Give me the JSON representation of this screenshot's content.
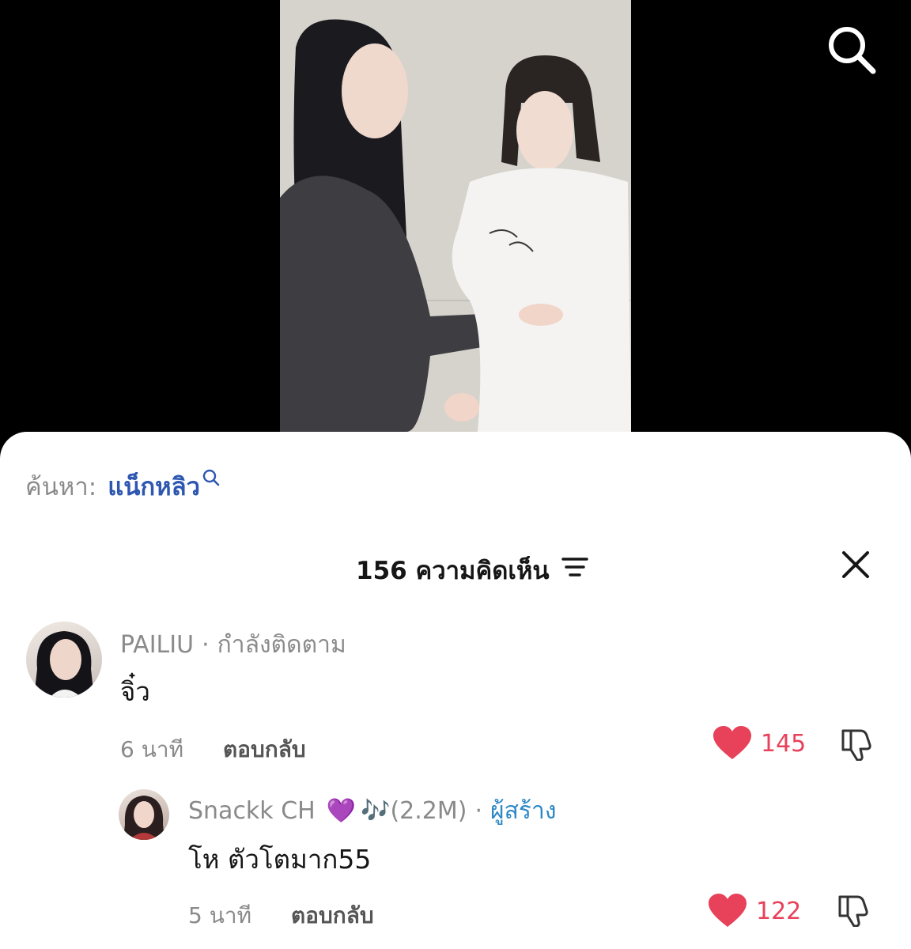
{
  "search_bar": {
    "prefix": "ค้นหา:",
    "term": "แน็กหลิว"
  },
  "comments_header": {
    "count_label": "156 ความคิดเห็น"
  },
  "comments": [
    {
      "username": "PAILIU",
      "relation": "กำลังติดตาม",
      "text": "จิ๋ว",
      "time": "6 นาที",
      "reply_label": "ตอบกลับ",
      "likes": "145"
    },
    {
      "username": "Snackk CH",
      "emoji": "💜",
      "music_label": "🎶(2.2M)",
      "badge": "ผู้สร้าง",
      "text": "โห ตัวโตมาก55",
      "time": "5 นาที",
      "reply_label": "ตอบกลับ",
      "likes": "122"
    }
  ],
  "colors": {
    "accent_blue": "#2d57b0",
    "like_red": "#e8415a",
    "creator_blue": "#2d88c6"
  }
}
